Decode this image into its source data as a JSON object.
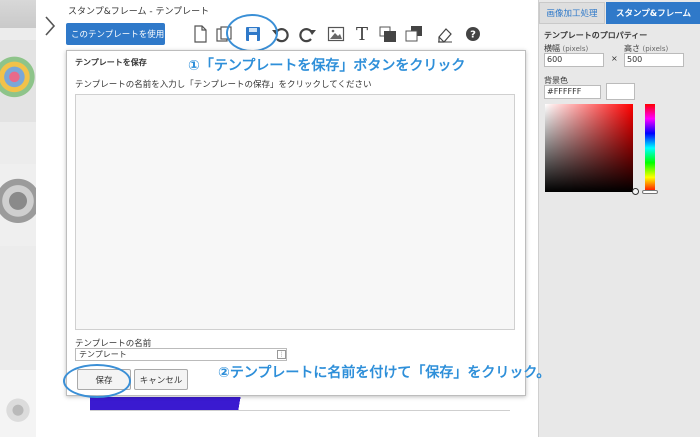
{
  "header": {
    "breadcrumb": "スタンプ&フレーム  -  テンプレート",
    "use_template_label": "このテンプレートを使用"
  },
  "toolbar": {
    "tools": [
      {
        "name": "new-document-icon"
      },
      {
        "name": "open-folder-icon"
      },
      {
        "name": "save-icon"
      },
      {
        "name": "undo-icon"
      },
      {
        "name": "redo-icon"
      },
      {
        "name": "image-icon"
      },
      {
        "name": "text-icon"
      },
      {
        "name": "send-backward-icon"
      },
      {
        "name": "bring-forward-icon"
      },
      {
        "name": "eraser-icon"
      },
      {
        "name": "help-icon"
      }
    ],
    "text_tool_glyph": "T",
    "help_glyph": "?"
  },
  "annotations": {
    "step1": "①「テンプレートを保存」ボタンをクリック",
    "step2": "②テンプレートに名前を付けて「保存」をクリック。"
  },
  "dialog": {
    "title": "テンプレートを保存",
    "instruction": "テンプレートの名前を入力し「テンプレートの保存」をクリックしてください",
    "name_label": "テンプレートの名前",
    "name_value": "テンプレート",
    "save_label": "保存",
    "cancel_label": "キャンセル"
  },
  "right_panel": {
    "tabs": [
      {
        "label": "画像加工処理",
        "active": false
      },
      {
        "label": "スタンプ&フレーム",
        "active": true
      }
    ],
    "properties_title": "テンプレートのプロパティー",
    "width_label": "横幅",
    "height_label": "高さ",
    "unit": "(pixels)",
    "width_value": "600",
    "times": "×",
    "height_value": "500",
    "bg_label": "背景色",
    "bg_color_value": "#FFFFFF"
  },
  "colors": {
    "accent": "#2f79c9",
    "annotation": "#2e8fd9",
    "background_swatch": "#FFFFFF"
  }
}
